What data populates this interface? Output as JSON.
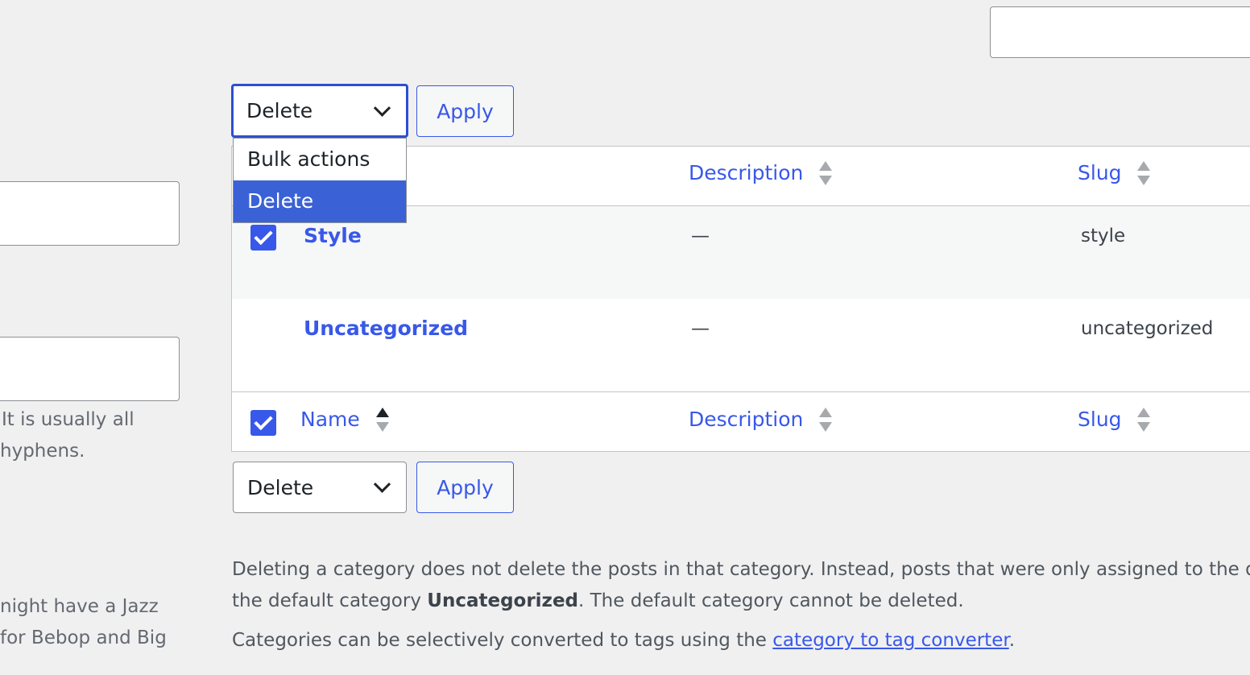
{
  "search": {
    "value": ""
  },
  "bulk_top": {
    "selected": "Delete",
    "apply_label": "Apply",
    "options": [
      "Bulk actions",
      "Delete"
    ]
  },
  "bulk_bottom": {
    "selected": "Delete",
    "apply_label": "Apply"
  },
  "table": {
    "header": {
      "description": "Description",
      "slug": "Slug"
    },
    "footer": {
      "name": "Name",
      "description": "Description",
      "slug": "Slug"
    },
    "rows": [
      {
        "name": "Style",
        "description": "—",
        "slug": "style",
        "checked": true
      },
      {
        "name": "Uncategorized",
        "description": "—",
        "slug": "uncategorized",
        "checked": false
      }
    ]
  },
  "left_form": {
    "slug_help_line1": "It is usually all",
    "slug_help_line2": "hyphens.",
    "parent_help_line1": "night have a Jazz",
    "parent_help_line2": "for Bebop and Big"
  },
  "notes": {
    "line1": "Deleting a category does not delete the posts in that category. Instead, posts that were only assigned to the de",
    "line2_prefix": "the default category ",
    "line2_bold": "Uncategorized",
    "line2_suffix": ". The default category cannot be deleted.",
    "line3_prefix": "Categories can be selectively converted to tags using the ",
    "line3_link": "category to tag converter",
    "line3_suffix": "."
  },
  "colors": {
    "accent": "#3858e9",
    "background": "#f0f0f1",
    "selected_option": "#3a62d6"
  }
}
